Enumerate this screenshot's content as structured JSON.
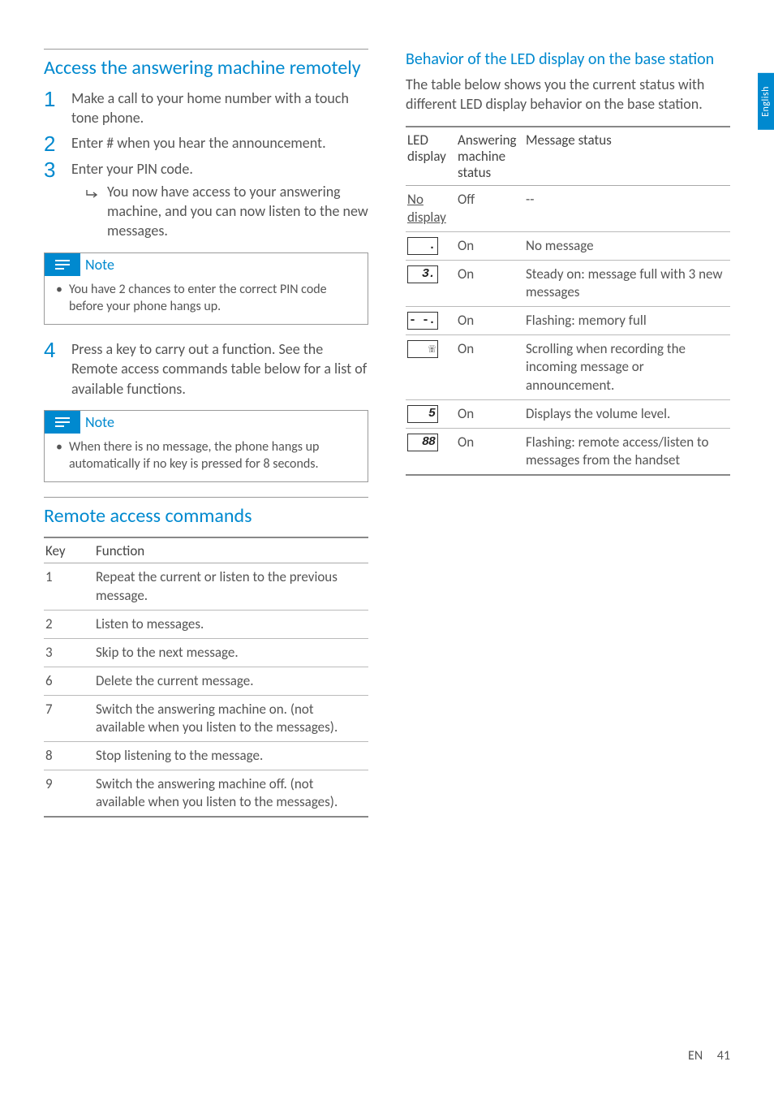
{
  "sideTab": "English",
  "footer": {
    "lang": "EN",
    "page": "41"
  },
  "left": {
    "h_access": "Access the answering machine remotely",
    "steps": {
      "s1": {
        "num": "1",
        "text": "Make a call to your home number with a touch tone phone."
      },
      "s2": {
        "num": "2",
        "text_a": "Enter ",
        "hash": "#",
        "text_b": " when you hear the announcement."
      },
      "s3": {
        "num": "3",
        "text": "Enter your PIN code.",
        "sub": "You now have access to your answering machine, and you can now listen to the new messages."
      },
      "s4": {
        "num": "4",
        "text": "Press a key to carry out a function. See the Remote access commands table below for a list of available functions."
      }
    },
    "note1": {
      "title": "Note",
      "text": "You have 2 chances to enter the correct PIN code before your phone hangs up."
    },
    "note2": {
      "title": "Note",
      "text": "When there is no message, the phone hangs up automatically if no key is pressed for 8 seconds."
    },
    "h_remote": "Remote access commands",
    "remoteHdr": {
      "c1": "Key",
      "c2": "Function"
    },
    "remote": [
      {
        "k": "1",
        "f": "Repeat the current or listen to the previous message."
      },
      {
        "k": "2",
        "f": "Listen to messages."
      },
      {
        "k": "3",
        "f": "Skip to the next message."
      },
      {
        "k": "6",
        "f": "Delete the current message."
      },
      {
        "k": "7",
        "f": "Switch the answering machine on. (not available when you listen to the messages)."
      },
      {
        "k": "8",
        "f": "Stop listening to the message."
      },
      {
        "k": "9",
        "f": "Switch the answering machine off. (not available when you listen to the messages)."
      }
    ]
  },
  "right": {
    "h_led": "Behavior of the LED display on the base station",
    "intro": "The table below shows you the current status with different LED display behavior on the base station.",
    "ledHdr": {
      "c1": "LED display",
      "c2": "Answering machine status",
      "c3": "Message status"
    },
    "led": [
      {
        "d": "No display",
        "s": "Off",
        "m": "--",
        "box": false
      },
      {
        "d": ".",
        "s": "On",
        "m": "No message",
        "box": true
      },
      {
        "d": "3.",
        "s": "On",
        "m": "Steady on: message full with 3 new messages",
        "box": true,
        "seg": true
      },
      {
        "d": "- -.",
        "s": "On",
        "m": "Flashing: memory full",
        "box": true
      },
      {
        "d": "☏",
        "s": "On",
        "m": "Scrolling when recording the incoming message or announcement.",
        "box": true
      },
      {
        "d": "5",
        "s": "On",
        "m": "Displays the volume level.",
        "box": true,
        "seg": true
      },
      {
        "d": "88",
        "s": "On",
        "m": "Flashing: remote access/listen to messages from the handset",
        "box": true,
        "seg": true
      }
    ]
  }
}
